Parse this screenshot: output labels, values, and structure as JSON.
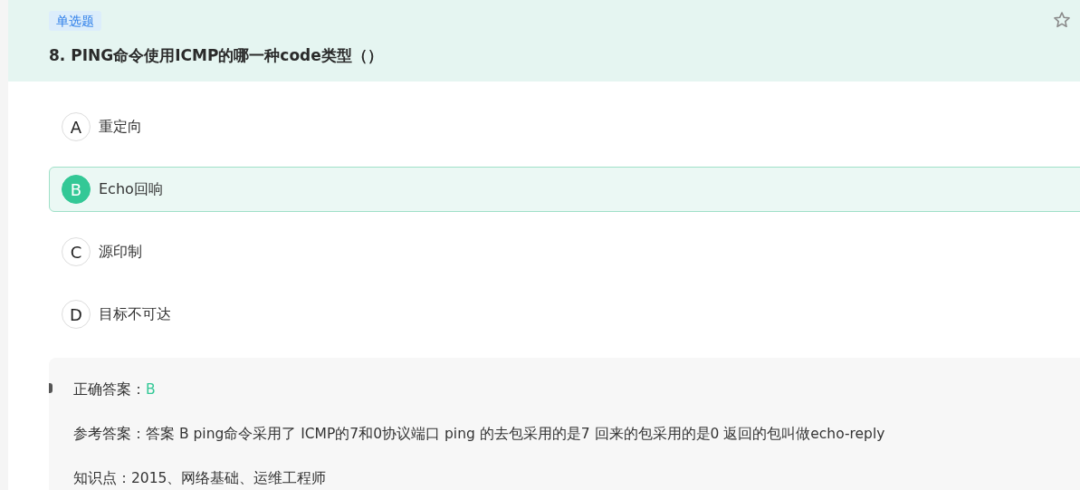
{
  "question": {
    "type_tag": "单选题",
    "title": "8. PING命令使用ICMP的哪一种code类型（）",
    "starred": false
  },
  "options": [
    {
      "letter": "A",
      "text": "重定向",
      "selected": false
    },
    {
      "letter": "B",
      "text": "Echo回响",
      "selected": true
    },
    {
      "letter": "C",
      "text": "源印制",
      "selected": false
    },
    {
      "letter": "D",
      "text": "目标不可达",
      "selected": false
    }
  ],
  "analysis": {
    "correct_label": "正确答案：",
    "correct_value": "B",
    "reference": "参考答案：答案 B ping命令采用了 ICMP的7和0协议端口 ping 的去包采用的是7 回来的包采用的是0 返回的包叫做echo-reply",
    "knowledge": "知识点：2015、网络基础、运维工程师"
  }
}
